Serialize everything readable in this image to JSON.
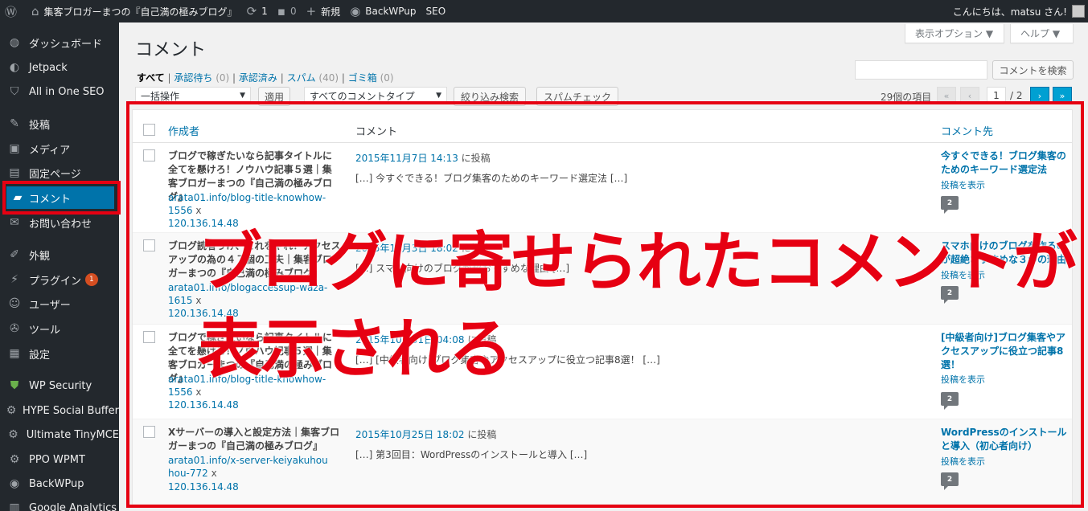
{
  "adminbar": {
    "site_name": "集客ブロガーまつの『自己満の極みブログ』",
    "updates_count": "1",
    "comments_count": "0",
    "new_label": "新規",
    "backwpup_label": "BackWPup",
    "seo_label": "SEO",
    "greeting": "こんにちは、matsu さん!"
  },
  "sidebar": {
    "items": [
      {
        "label": "ダッシュボード",
        "icon": "dashboard-icon"
      },
      {
        "label": "Jetpack",
        "icon": "jetpack-icon"
      },
      {
        "label": "All in One SEO",
        "icon": "shield-icon"
      },
      {
        "label": "投稿",
        "icon": "pin-icon"
      },
      {
        "label": "メディア",
        "icon": "media-icon"
      },
      {
        "label": "固定ページ",
        "icon": "page-icon"
      },
      {
        "label": "コメント",
        "icon": "comment-icon"
      },
      {
        "label": "お問い合わせ",
        "icon": "mail-icon"
      },
      {
        "label": "外観",
        "icon": "brush-icon"
      },
      {
        "label": "プラグイン",
        "icon": "plugin-icon",
        "badge": "1"
      },
      {
        "label": "ユーザー",
        "icon": "user-icon"
      },
      {
        "label": "ツール",
        "icon": "wrench-icon"
      },
      {
        "label": "設定",
        "icon": "settings-icon"
      },
      {
        "label": "WP Security",
        "icon": "shield-check-icon"
      },
      {
        "label": "HYPE Social Buffer",
        "icon": "gear-icon"
      },
      {
        "label": "Ultimate TinyMCE",
        "icon": "gear-icon"
      },
      {
        "label": "PPO WPMT",
        "icon": "gear-icon"
      },
      {
        "label": "BackWPup",
        "icon": "backwpup-icon"
      },
      {
        "label": "Google Analytics",
        "icon": "analytics-icon"
      }
    ]
  },
  "header": {
    "screen_options": "表示オプション ▼",
    "help": "ヘルプ ▼",
    "title": "コメント"
  },
  "filters": {
    "all": "すべて",
    "pending": "承認待ち",
    "pending_count": "(0)",
    "approved": "承認済み",
    "spam": "スパム",
    "spam_count": "(40)",
    "trash": "ゴミ箱",
    "trash_count": "(0)"
  },
  "search": {
    "button": "コメントを検索"
  },
  "toolbar": {
    "bulk_actions": "一括操作",
    "apply": "適用",
    "comment_type": "すべてのコメントタイプ",
    "filter": "絞り込み検索",
    "spam_check": "スパムチェック",
    "items_count": "29個の項目",
    "first": "«",
    "prev": "‹",
    "current_page": "1",
    "total_pages": "/ 2",
    "next": "›",
    "last": "»"
  },
  "table": {
    "col_author": "作成者",
    "col_comment": "コメント",
    "col_response": "コメント先",
    "rows": [
      {
        "author": "ブログで稼ぎたいなら記事タイトルに全てを懸けろ！ノウハウ記事５選｜集客ブロガーまつの『自己満の極みブログ』",
        "url": "arata01.info/blog-title-knowhow-1556",
        "url_suffix": "x",
        "ip": "120.136.14.48",
        "date": "2015年11月7日 14:13",
        "posted": "に投稿",
        "excerpt": "[…] 今すぐできる！ブログ集客のためのキーワード選定法 […]",
        "response": "今すぐできる！ブログ集客のためのキーワード選定法",
        "view_post": "投稿を表示",
        "count": "2"
      },
      {
        "author": "ブログ読者うけ、これをやれ！アクセスアップの為の４７個の工夫｜集客ブロガーまつの『自己満の極みブログ』",
        "url": "arata01.info/blogaccessup-waza-1615",
        "url_suffix": "x",
        "ip": "120.136.14.48",
        "date": "2015年11月3日 18:02",
        "posted": "に投稿",
        "excerpt": "[…] スマホ向けのブログが超おすすめな理由 […]",
        "response": "スマホ向けのブログを作るのが超絶おすすめな３つの理由",
        "view_post": "投稿を表示",
        "count": "2"
      },
      {
        "author": "ブログで稼ぎたいなら記事タイトルに全てを懸けろ！ノウハウ記事５選｜集客ブロガーまつの『自己満の極みブログ』",
        "url": "arata01.info/blog-title-knowhow-1556",
        "url_suffix": "x",
        "ip": "120.136.14.48",
        "date": "2015年10月31日 04:08",
        "posted": "に投稿",
        "excerpt": "[…] [中級者向け]ブログ集客やアクセスアップに役立つ記事8選！ […]",
        "response": "[中級者向け]ブログ集客やアクセスアップに役立つ記事8選！",
        "view_post": "投稿を表示",
        "count": "2"
      },
      {
        "author": "Xサーバーの導入と設定方法｜集客ブロガーまつの『自己満の極みブログ』",
        "url": "arata01.info/x-server-keiyakuhouhou-772",
        "url_suffix": "x",
        "ip": "120.136.14.48",
        "date": "2015年10月25日 18:02",
        "posted": "に投稿",
        "excerpt": "[…] 第3回目：WordPressのインストールと導入 […]",
        "response": "WordPressのインストールと導入（初心者向け）",
        "view_post": "投稿を表示",
        "count": "2"
      }
    ]
  },
  "annotation": {
    "line1": "ブログに寄せられたコメントが",
    "line2": "表示される"
  },
  "colors": {
    "accent": "#0073aa",
    "highlight": "#e60012",
    "adminbar": "#23282d"
  }
}
